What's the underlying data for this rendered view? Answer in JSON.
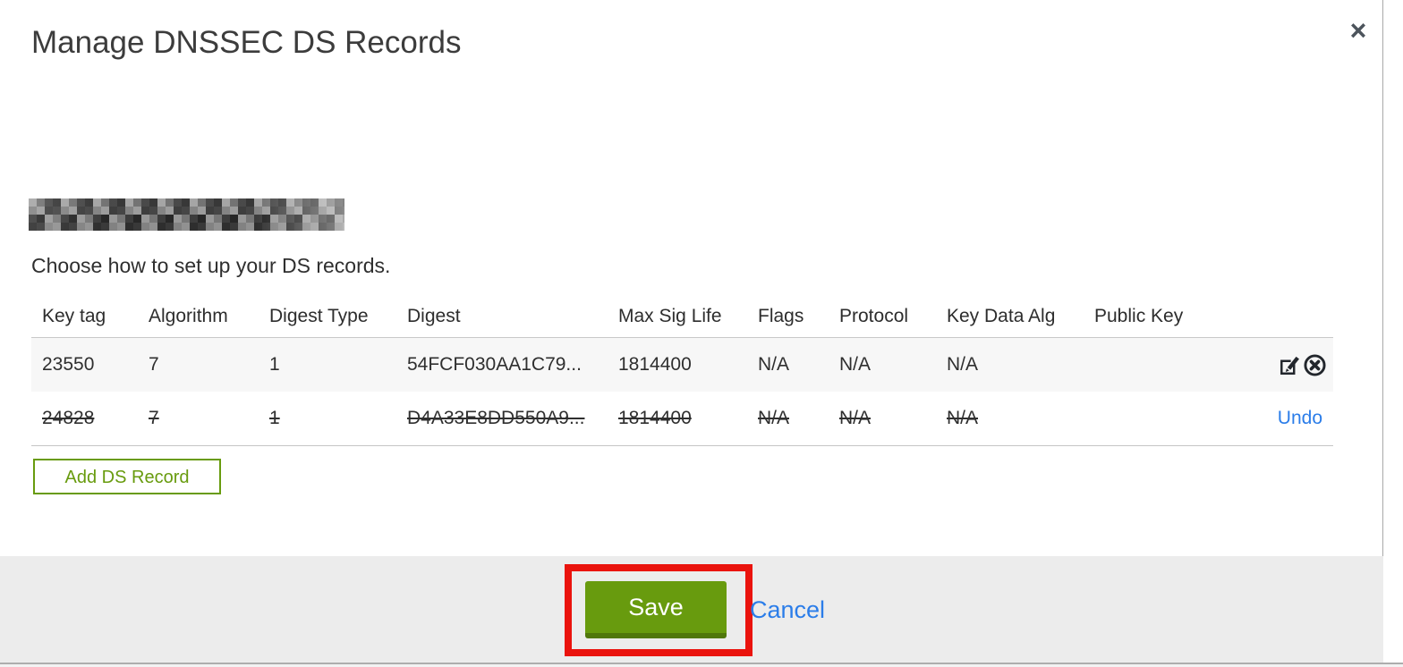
{
  "modal": {
    "title": "Manage DNSSEC DS Records",
    "close_glyph": "×",
    "domain": {
      "redacted": true
    },
    "instruction": "Choose how to set up your DS records."
  },
  "table": {
    "headers": [
      "Key tag",
      "Algorithm",
      "Digest Type",
      "Digest",
      "Max Sig Life",
      "Flags",
      "Protocol",
      "Key Data Alg",
      "Public Key"
    ],
    "rows": [
      {
        "state": "active",
        "cells": [
          "23550",
          "7",
          "1",
          "54FCF030AA1C79...",
          "1814400",
          "N/A",
          "N/A",
          "N/A",
          ""
        ],
        "actions": [
          "edit-icon",
          "delete-icon"
        ]
      },
      {
        "state": "deleted-pending",
        "cells": [
          "24828",
          "7",
          "1",
          "D4A33E8DD550A9...",
          "1814400",
          "N/A",
          "N/A",
          "N/A",
          ""
        ],
        "undo_label": "Undo"
      }
    ]
  },
  "buttons": {
    "add_ds_record": "Add DS Record",
    "save": "Save",
    "cancel": "Cancel"
  },
  "annotation": {
    "type": "highlight-rectangle",
    "target": "save-button",
    "color": "#ea130d"
  },
  "colors": {
    "action_green": "#689b0e",
    "action_green_dark": "#50770b",
    "link_blue": "#2b7de9",
    "footer_bg": "#ececec",
    "row_active_bg": "#f7f7f7",
    "annotation_red": "#ea130d"
  }
}
